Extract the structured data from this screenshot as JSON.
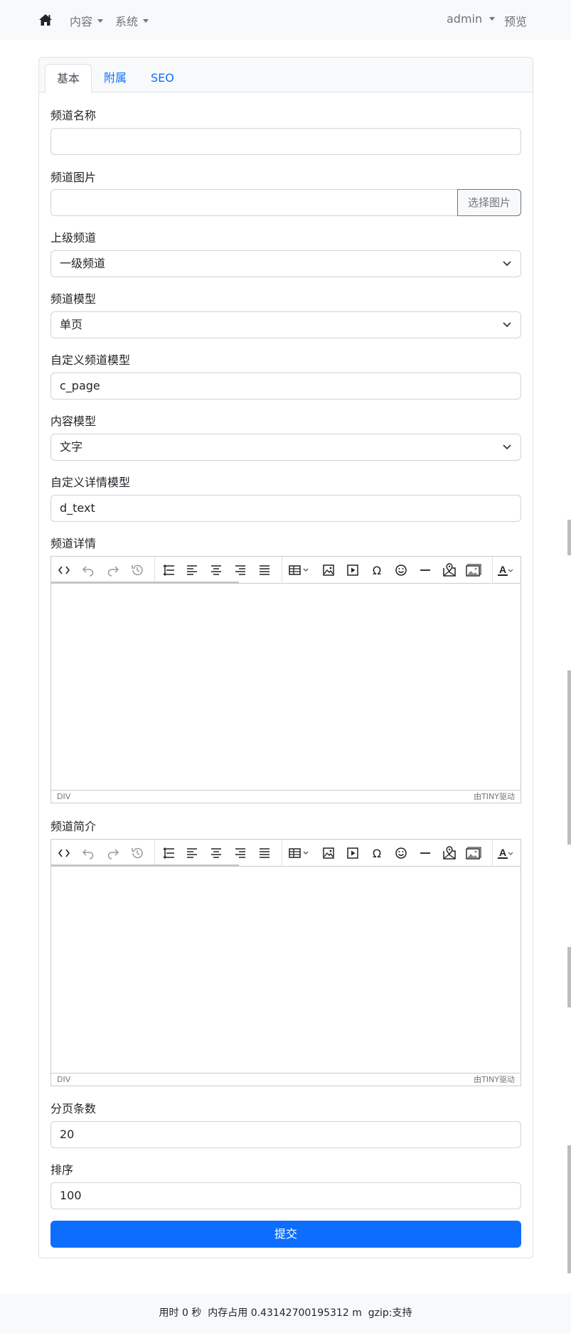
{
  "nav": {
    "content_label": "内容",
    "system_label": "系统",
    "user_label": "admin",
    "preview_label": "预览"
  },
  "tabs": [
    {
      "label": "基本",
      "active": true
    },
    {
      "label": "附属",
      "active": false
    },
    {
      "label": "SEO",
      "active": false
    }
  ],
  "form": {
    "channel_name": {
      "label": "频道名称",
      "value": ""
    },
    "channel_image": {
      "label": "频道图片",
      "value": "",
      "button": "选择图片"
    },
    "parent_channel": {
      "label": "上级频道",
      "selected": "一级频道"
    },
    "channel_model": {
      "label": "频道模型",
      "selected": "单页"
    },
    "custom_channel_model": {
      "label": "自定义频道模型",
      "value": "c_page"
    },
    "content_model": {
      "label": "内容模型",
      "selected": "文字"
    },
    "custom_detail_model": {
      "label": "自定义详情模型",
      "value": "d_text"
    },
    "channel_detail": {
      "label": "频道详情"
    },
    "channel_intro": {
      "label": "频道简介"
    },
    "page_size": {
      "label": "分页条数",
      "value": "20"
    },
    "sort": {
      "label": "排序",
      "value": "100"
    },
    "submit_label": "提交"
  },
  "editor": {
    "status_path": "DIV",
    "brand": "由TINY驱动",
    "color_glyph": "A",
    "tools": [
      "code-icon",
      "undo-icon",
      "redo-icon",
      "restore-draft-icon",
      "line-height-icon",
      "align-left-icon",
      "align-center-icon",
      "align-right-icon",
      "align-justify-icon",
      "table-icon",
      "image-icon",
      "media-icon",
      "charmap-icon",
      "emoticons-icon",
      "hr-icon",
      "bdmap-icon",
      "image-gallery-icon",
      "forecolor-icon"
    ]
  },
  "footer": {
    "text": "用时 0 秒  内存占用 0.43142700195312 m  gzip:支持"
  },
  "colors": {
    "primary": "#0d6efd",
    "nav_bg": "#f8f9fa",
    "border": "#ced4da",
    "muted": "#6c757d"
  }
}
